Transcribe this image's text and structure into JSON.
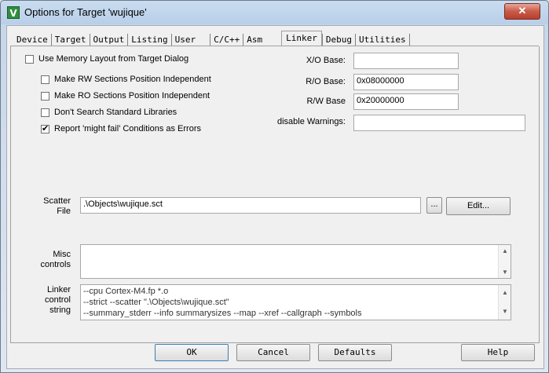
{
  "window": {
    "title": "Options for Target 'wujique'",
    "app_icon": "V",
    "close_label": "✕"
  },
  "tabs": [
    {
      "label": "Device"
    },
    {
      "label": "Target"
    },
    {
      "label": "Output"
    },
    {
      "label": "Listing"
    },
    {
      "label": "User"
    },
    {
      "label": "C/C++"
    },
    {
      "label": "Asm"
    },
    {
      "label": "Linker"
    },
    {
      "label": "Debug"
    },
    {
      "label": "Utilities"
    }
  ],
  "linker": {
    "use_memory_layout": {
      "label": "Use Memory Layout from Target Dialog",
      "checked": false
    },
    "rw_independent": {
      "label": "Make RW Sections Position Independent",
      "checked": false
    },
    "ro_independent": {
      "label": "Make RO Sections Position Independent",
      "checked": false
    },
    "no_std_libs": {
      "label": "Don't Search Standard Libraries",
      "checked": false
    },
    "might_fail": {
      "label": "Report 'might fail' Conditions as Errors",
      "checked": true
    },
    "xo_base": {
      "label": "X/O Base:",
      "value": ""
    },
    "ro_base": {
      "label": "R/O Base:",
      "value": "0x08000000"
    },
    "rw_base": {
      "label": "R/W Base",
      "value": "0x20000000"
    },
    "disable_warnings": {
      "label": "disable Warnings:",
      "value": ""
    },
    "scatter": {
      "label_line1": "Scatter",
      "label_line2": "File",
      "value": ".\\Objects\\wujique.sct",
      "browse_label": "...",
      "edit_label": "Edit..."
    },
    "misc": {
      "label_line1": "Misc",
      "label_line2": "controls",
      "value": ""
    },
    "control_string": {
      "label_line1": "Linker",
      "label_line2": "control",
      "label_line3": "string",
      "lines": [
        "--cpu Cortex-M4.fp *.o",
        "--strict --scatter \".\\Objects\\wujique.sct\"",
        "--summary_stderr --info summarysizes --map --xref --callgraph --symbols"
      ]
    }
  },
  "buttons": {
    "ok": "OK",
    "cancel": "Cancel",
    "defaults": "Defaults",
    "help": "Help"
  }
}
